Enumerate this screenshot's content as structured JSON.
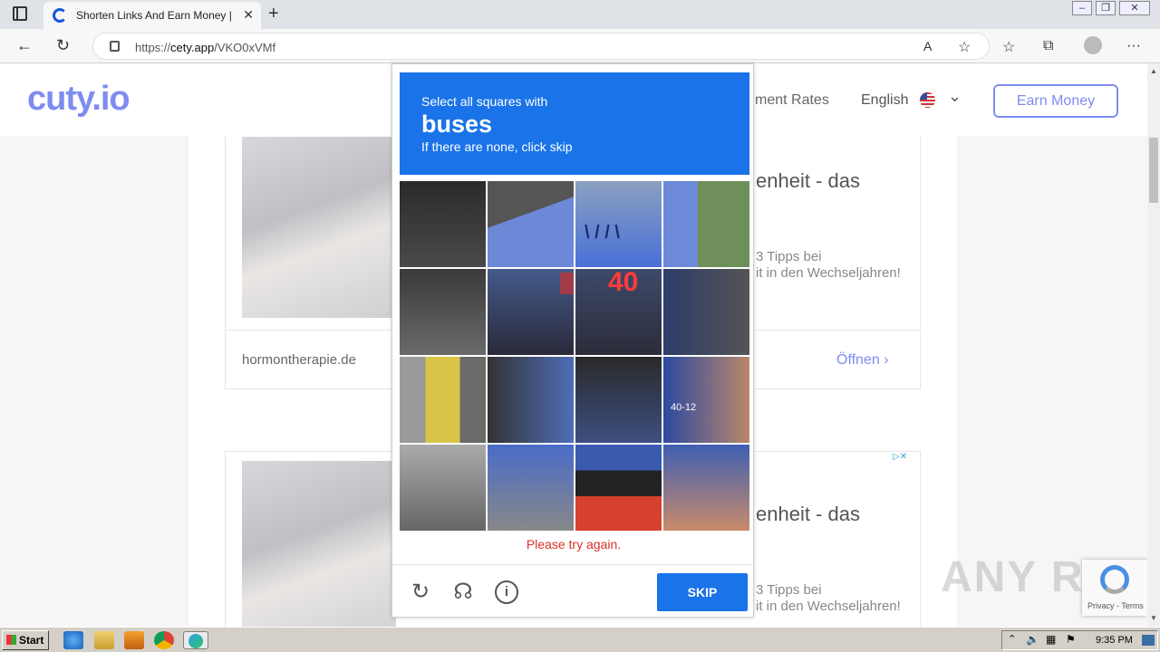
{
  "browser": {
    "tab_title": "Shorten Links And Earn Money | c",
    "url_prefix": "https://",
    "url_host": "cety.app",
    "url_path": "/VKO0xVMf"
  },
  "site": {
    "logo": "cuty.io",
    "nav_rates": "ment Rates",
    "nav_language": "English",
    "earn_button": "Earn Money"
  },
  "ads": [
    {
      "headline": "enheit - das",
      "sub_line1": "3 Tipps bei",
      "sub_line2": "it in den Wechseljahren!",
      "domain": "hormontherapie.de",
      "open_label": "Öffnen"
    },
    {
      "headline": "enheit - das",
      "sub_line1": "3 Tipps bei",
      "sub_line2": "it in den Wechseljahren!"
    }
  ],
  "captcha": {
    "line1": "Select all squares with",
    "target": "buses",
    "line3": "If there are none, click skip",
    "bus_number": "40",
    "bus_plate": "40-12",
    "error": "Please try again.",
    "skip_label": "SKIP"
  },
  "recaptcha_badge": {
    "links": "Privacy - Terms"
  },
  "watermark": "ANY RUN",
  "taskbar": {
    "start_label": "Start",
    "clock": "9:35 PM"
  }
}
